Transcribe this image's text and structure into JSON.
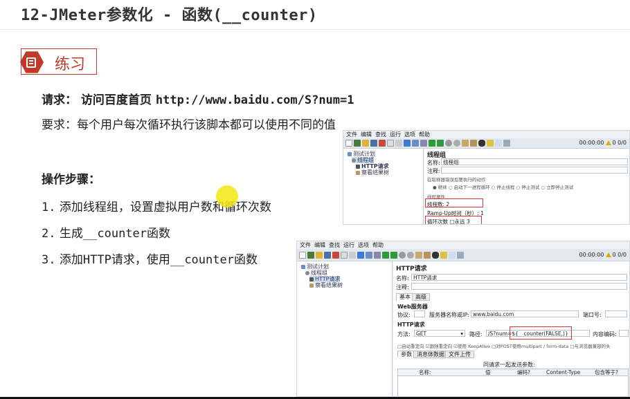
{
  "slide": {
    "title": "12-JMeter参数化 - 函数(__counter)",
    "badge_label": "练习",
    "req1_label": "请求：  访问百度首页",
    "req1_url": "http://www.baidu.com/S?num=1",
    "req2": "要求：每个用户每次循环执行该脚本都可以使用不同的值",
    "steps_heading": "操作步骤：",
    "step1_num": "1.",
    "step1_text": "添加线程组，设置虚拟用户数和循环次数",
    "step2_num": "2.",
    "step2_pre": "生成",
    "step2_code": "__counter",
    "step2_post": "函数",
    "step3_num": "3.",
    "step3_pre": "添加",
    "step3_code1": "HTTP",
    "step3_mid": "请求，使用",
    "step3_code2": "__counter",
    "step3_post": "函数"
  },
  "jmeter1": {
    "menu": [
      "文件",
      "编辑",
      "查找",
      "运行",
      "选项",
      "帮助"
    ],
    "timer": "00:00:00",
    "status": "0 0/0",
    "tree": [
      "测试计划",
      "线程组",
      "HTTP请求",
      "察看结果树"
    ],
    "panel_title": "线程组",
    "name_label": "名称:",
    "name_value": "线程组",
    "comment_label": "注释:",
    "error_action_label": "在取样器错误后要执行的动作",
    "error_options": [
      "继续",
      "启动下一进程循环",
      "停止线程",
      "停止测试",
      "立即停止测试"
    ],
    "thread_props_label": "线程属性",
    "threads_label": "线程数:",
    "threads_value": "2",
    "rampup_label": "Ramp-Up时间（秒）:",
    "rampup_value": "1",
    "loop_label": "循环次数",
    "loop_forever": "永远",
    "loop_value": "3"
  },
  "jmeter2": {
    "menu": [
      "文件",
      "编辑",
      "查找",
      "运行",
      "选项",
      "帮助"
    ],
    "timer": "00:00:00",
    "status": "0 0/0",
    "tree": [
      "测试计划",
      "线程组",
      "HTTP请求",
      "察看结果树"
    ],
    "panel_title": "HTTP请求",
    "name_label": "名称:",
    "name_value": "HTTP请求",
    "comment_label": "注释:",
    "tabs": [
      "基本",
      "高级"
    ],
    "web_server_label": "Web服务器",
    "protocol_label": "协议:",
    "server_label": "服务器名称或IP:",
    "server_value": "www.baidu.com",
    "port_label": "端口号:",
    "http_request_label": "HTTP请求",
    "method_label": "方法:",
    "method_value": "GET",
    "path_label": "路径:",
    "path_value": "/S?num=",
    "path_func": "${__counter(FALSE,)}",
    "encoding_label": "内容编码:",
    "checkboxes": [
      "自动重定向",
      "跟随重定向",
      "使用 KeepAlive",
      "对POST使用multipart / form-data",
      "与浏览器兼容的头"
    ],
    "subtabs": [
      "参数",
      "消息体数据",
      "文件上传"
    ],
    "params_title": "同请求一起发送参数:",
    "columns": [
      "名称:",
      "值",
      "编码?",
      "Content-Type",
      "包含等于?"
    ]
  },
  "colors": {
    "accent_red": "#c0392b",
    "highlight_yellow": "#f5e614",
    "redbox": "#d9342b"
  }
}
